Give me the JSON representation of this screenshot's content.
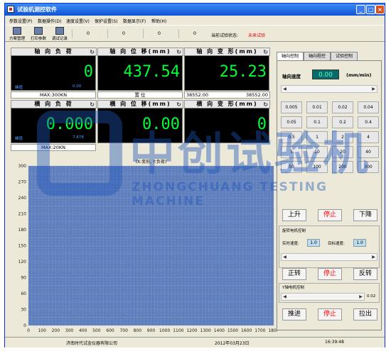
{
  "window": {
    "title": "试验机测控软件"
  },
  "menu": [
    "参数设置(P)",
    "数据操作(D)",
    "速度设置(V)",
    "保护设置(S)",
    "数据显示(F)",
    "帮助(H)"
  ],
  "toolbar": {
    "tools": [
      "方案管理",
      "打印参数",
      "调试记录"
    ],
    "counters": [
      "0",
      "0",
      "0",
      "0",
      "0"
    ],
    "status_label": "当前试验状态:",
    "status_value": "未来试验"
  },
  "panels": {
    "axial_load": {
      "title": "轴 向 负 荷",
      "value": "0",
      "peak_label": "峰值",
      "peak_value": "0.00",
      "footer": "MAX:300KN"
    },
    "axial_disp": {
      "title": "轴 向 位 移(mm)",
      "value": "437.54",
      "footer": "置    位"
    },
    "axial_def": {
      "title": "轴 向 变 形(mm)",
      "value": "25.23",
      "footer_left": "38552.00",
      "footer_right": "38552.00"
    },
    "lateral_load": {
      "title": "横 向 负 荷",
      "value": "0.000",
      "peak_label": "峰值",
      "peak_value": "7.878",
      "footer": "MAX:20KN"
    },
    "lateral_disp": {
      "title": "横 向 位 移(mm)",
      "value": "0.00"
    },
    "lateral_def": {
      "title": "横 向 变 形(mm)",
      "value": "0"
    }
  },
  "chart_data": {
    "type": "line",
    "title": "(X:变形, Y:负荷)",
    "x_ticks": [
      0,
      100,
      200,
      300,
      400,
      500,
      600,
      700,
      800,
      900,
      1000,
      1100,
      1200,
      1300,
      1400,
      1500,
      1600,
      1700,
      1800
    ],
    "y_ticks": [
      0,
      30,
      60,
      90,
      120,
      150,
      180,
      210,
      240,
      270,
      300
    ],
    "xlim": [
      0,
      1800
    ],
    "ylim": [
      0,
      300
    ],
    "grid": true,
    "series": []
  },
  "right_panel": {
    "tabs": [
      "轴向控制",
      "轴向程控",
      "试验控制"
    ],
    "speed_label": "轴向速度",
    "speed_value": "0.00",
    "speed_unit": "(mm/min)",
    "speed_presets": [
      "0.005",
      "0.01",
      "0.02",
      "0.04",
      "0.05",
      "0.1",
      "0.2",
      "0.4",
      "0.5",
      "1",
      "2",
      "4",
      "5",
      "10",
      "20",
      "40",
      "50",
      "100",
      "200",
      "300"
    ],
    "up_label": "上升",
    "stop_label": "停止",
    "down_label": "下降",
    "rotary_section": "旋转电机控制",
    "realtime_speed_label": "实时速度:",
    "realtime_speed_value": "1.0",
    "target_speed_label": "目标速度:",
    "target_speed_value": "1.0",
    "forward_label": "正转",
    "stop2_label": "停止",
    "reverse_label": "反转",
    "y_motor_section": "Y轴电机控制",
    "y_scroll_value": "0.02",
    "push_label": "推进",
    "stop3_label": "停止",
    "pull_label": "拉出"
  },
  "statusbar": {
    "company": "济南时代试金仪器有限公司",
    "date": "2012年03月23日",
    "time": "16:39:48"
  },
  "watermark": {
    "cn": "中创试验机",
    "en": "ZHONGCHUANG TESTING MACHINE"
  }
}
